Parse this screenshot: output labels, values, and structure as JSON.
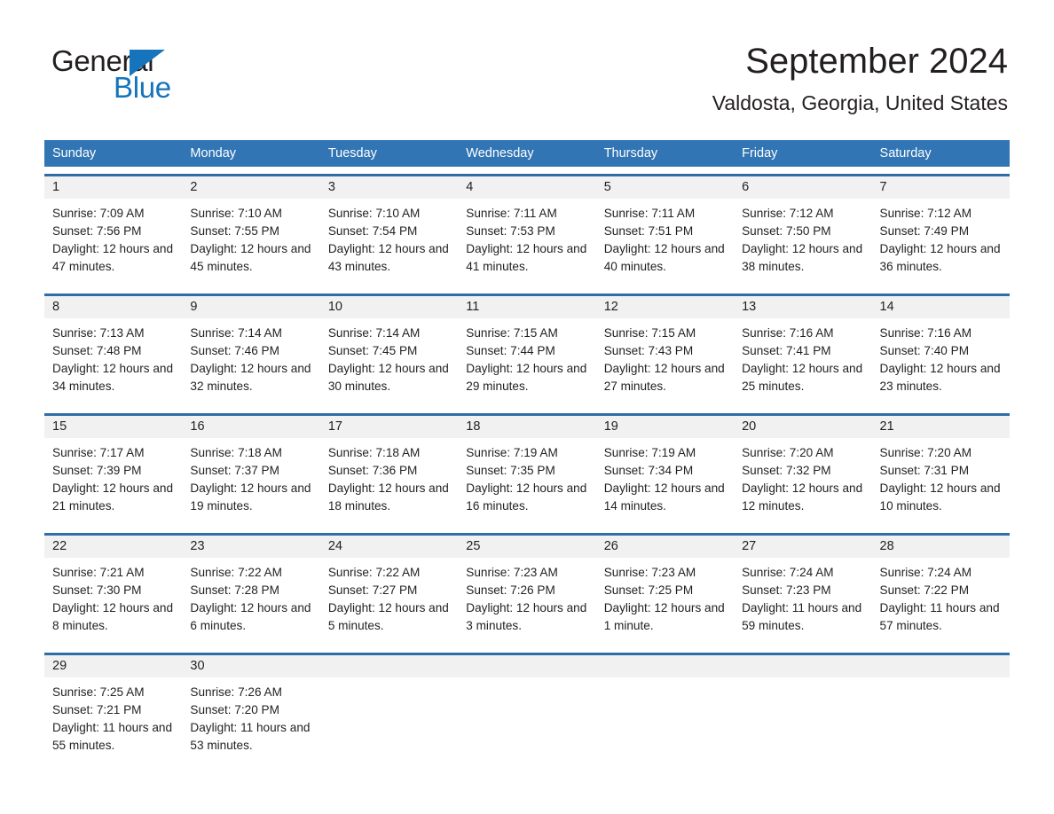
{
  "brand": {
    "name_part1": "General",
    "name_part2": "Blue",
    "accent_color": "#1574bb"
  },
  "header": {
    "title": "September 2024",
    "location": "Valdosta, Georgia, United States"
  },
  "theme": {
    "header_blue": "#3175b4",
    "rule_blue": "#2e6da7",
    "datebar_gray": "#f1f1f1"
  },
  "weekdays": [
    "Sunday",
    "Monday",
    "Tuesday",
    "Wednesday",
    "Thursday",
    "Friday",
    "Saturday"
  ],
  "weeks": [
    [
      {
        "day": "1",
        "sunrise": "Sunrise: 7:09 AM",
        "sunset": "Sunset: 7:56 PM",
        "daylight": "Daylight: 12 hours and 47 minutes."
      },
      {
        "day": "2",
        "sunrise": "Sunrise: 7:10 AM",
        "sunset": "Sunset: 7:55 PM",
        "daylight": "Daylight: 12 hours and 45 minutes."
      },
      {
        "day": "3",
        "sunrise": "Sunrise: 7:10 AM",
        "sunset": "Sunset: 7:54 PM",
        "daylight": "Daylight: 12 hours and 43 minutes."
      },
      {
        "day": "4",
        "sunrise": "Sunrise: 7:11 AM",
        "sunset": "Sunset: 7:53 PM",
        "daylight": "Daylight: 12 hours and 41 minutes."
      },
      {
        "day": "5",
        "sunrise": "Sunrise: 7:11 AM",
        "sunset": "Sunset: 7:51 PM",
        "daylight": "Daylight: 12 hours and 40 minutes."
      },
      {
        "day": "6",
        "sunrise": "Sunrise: 7:12 AM",
        "sunset": "Sunset: 7:50 PM",
        "daylight": "Daylight: 12 hours and 38 minutes."
      },
      {
        "day": "7",
        "sunrise": "Sunrise: 7:12 AM",
        "sunset": "Sunset: 7:49 PM",
        "daylight": "Daylight: 12 hours and 36 minutes."
      }
    ],
    [
      {
        "day": "8",
        "sunrise": "Sunrise: 7:13 AM",
        "sunset": "Sunset: 7:48 PM",
        "daylight": "Daylight: 12 hours and 34 minutes."
      },
      {
        "day": "9",
        "sunrise": "Sunrise: 7:14 AM",
        "sunset": "Sunset: 7:46 PM",
        "daylight": "Daylight: 12 hours and 32 minutes."
      },
      {
        "day": "10",
        "sunrise": "Sunrise: 7:14 AM",
        "sunset": "Sunset: 7:45 PM",
        "daylight": "Daylight: 12 hours and 30 minutes."
      },
      {
        "day": "11",
        "sunrise": "Sunrise: 7:15 AM",
        "sunset": "Sunset: 7:44 PM",
        "daylight": "Daylight: 12 hours and 29 minutes."
      },
      {
        "day": "12",
        "sunrise": "Sunrise: 7:15 AM",
        "sunset": "Sunset: 7:43 PM",
        "daylight": "Daylight: 12 hours and 27 minutes."
      },
      {
        "day": "13",
        "sunrise": "Sunrise: 7:16 AM",
        "sunset": "Sunset: 7:41 PM",
        "daylight": "Daylight: 12 hours and 25 minutes."
      },
      {
        "day": "14",
        "sunrise": "Sunrise: 7:16 AM",
        "sunset": "Sunset: 7:40 PM",
        "daylight": "Daylight: 12 hours and 23 minutes."
      }
    ],
    [
      {
        "day": "15",
        "sunrise": "Sunrise: 7:17 AM",
        "sunset": "Sunset: 7:39 PM",
        "daylight": "Daylight: 12 hours and 21 minutes."
      },
      {
        "day": "16",
        "sunrise": "Sunrise: 7:18 AM",
        "sunset": "Sunset: 7:37 PM",
        "daylight": "Daylight: 12 hours and 19 minutes."
      },
      {
        "day": "17",
        "sunrise": "Sunrise: 7:18 AM",
        "sunset": "Sunset: 7:36 PM",
        "daylight": "Daylight: 12 hours and 18 minutes."
      },
      {
        "day": "18",
        "sunrise": "Sunrise: 7:19 AM",
        "sunset": "Sunset: 7:35 PM",
        "daylight": "Daylight: 12 hours and 16 minutes."
      },
      {
        "day": "19",
        "sunrise": "Sunrise: 7:19 AM",
        "sunset": "Sunset: 7:34 PM",
        "daylight": "Daylight: 12 hours and 14 minutes."
      },
      {
        "day": "20",
        "sunrise": "Sunrise: 7:20 AM",
        "sunset": "Sunset: 7:32 PM",
        "daylight": "Daylight: 12 hours and 12 minutes."
      },
      {
        "day": "21",
        "sunrise": "Sunrise: 7:20 AM",
        "sunset": "Sunset: 7:31 PM",
        "daylight": "Daylight: 12 hours and 10 minutes."
      }
    ],
    [
      {
        "day": "22",
        "sunrise": "Sunrise: 7:21 AM",
        "sunset": "Sunset: 7:30 PM",
        "daylight": "Daylight: 12 hours and 8 minutes."
      },
      {
        "day": "23",
        "sunrise": "Sunrise: 7:22 AM",
        "sunset": "Sunset: 7:28 PM",
        "daylight": "Daylight: 12 hours and 6 minutes."
      },
      {
        "day": "24",
        "sunrise": "Sunrise: 7:22 AM",
        "sunset": "Sunset: 7:27 PM",
        "daylight": "Daylight: 12 hours and 5 minutes."
      },
      {
        "day": "25",
        "sunrise": "Sunrise: 7:23 AM",
        "sunset": "Sunset: 7:26 PM",
        "daylight": "Daylight: 12 hours and 3 minutes."
      },
      {
        "day": "26",
        "sunrise": "Sunrise: 7:23 AM",
        "sunset": "Sunset: 7:25 PM",
        "daylight": "Daylight: 12 hours and 1 minute."
      },
      {
        "day": "27",
        "sunrise": "Sunrise: 7:24 AM",
        "sunset": "Sunset: 7:23 PM",
        "daylight": "Daylight: 11 hours and 59 minutes."
      },
      {
        "day": "28",
        "sunrise": "Sunrise: 7:24 AM",
        "sunset": "Sunset: 7:22 PM",
        "daylight": "Daylight: 11 hours and 57 minutes."
      }
    ],
    [
      {
        "day": "29",
        "sunrise": "Sunrise: 7:25 AM",
        "sunset": "Sunset: 7:21 PM",
        "daylight": "Daylight: 11 hours and 55 minutes."
      },
      {
        "day": "30",
        "sunrise": "Sunrise: 7:26 AM",
        "sunset": "Sunset: 7:20 PM",
        "daylight": "Daylight: 11 hours and 53 minutes."
      },
      {
        "day": "",
        "sunrise": "",
        "sunset": "",
        "daylight": ""
      },
      {
        "day": "",
        "sunrise": "",
        "sunset": "",
        "daylight": ""
      },
      {
        "day": "",
        "sunrise": "",
        "sunset": "",
        "daylight": ""
      },
      {
        "day": "",
        "sunrise": "",
        "sunset": "",
        "daylight": ""
      },
      {
        "day": "",
        "sunrise": "",
        "sunset": "",
        "daylight": ""
      }
    ]
  ]
}
